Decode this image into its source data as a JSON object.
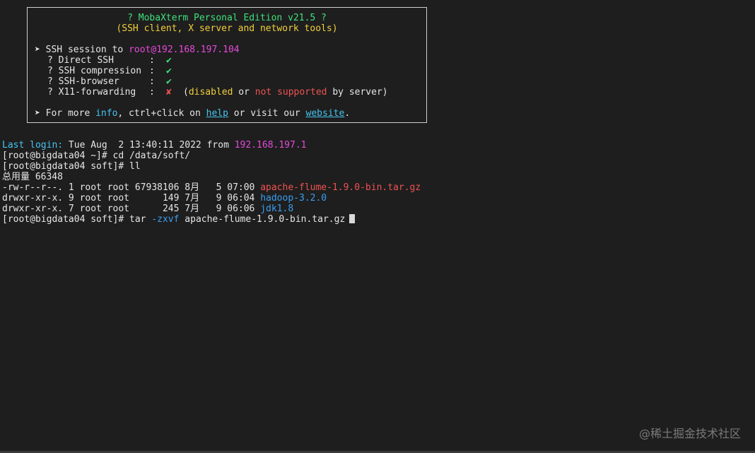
{
  "banner": {
    "title": "? MobaXterm Personal Edition v21.5 ?",
    "subtitle": "(SSH client, X server and network tools)",
    "session_prefix": "➤ SSH session to ",
    "session_target": "root@192.168.197.104",
    "checks": [
      {
        "mark": "?",
        "label": "Direct SSH",
        "value": "✔"
      },
      {
        "mark": "?",
        "label": "SSH compression",
        "value": "✔"
      },
      {
        "mark": "?",
        "label": "SSH-browser",
        "value": "✔"
      },
      {
        "mark": "?",
        "label": "X11-forwarding",
        "value": "✘"
      }
    ],
    "x11_paren_open": "(",
    "x11_disabled": "disabled",
    "x11_or": " or ",
    "x11_not_supported": "not supported",
    "x11_by_server": " by server)",
    "more_prefix": "➤ For more ",
    "more_info": "info",
    "more_mid": ", ctrl+click on ",
    "more_help": "help",
    "more_or": " or visit our ",
    "more_website": "website",
    "more_end": "."
  },
  "terminal": {
    "last_login_label": "Last login:",
    "last_login_time": " Tue Aug  2 13:40:11 2022 from ",
    "last_login_ip": "192.168.197.1",
    "line_cd": "[root@bigdata04 ~]# cd /data/soft/",
    "line_ll": "[root@bigdata04 soft]# ll",
    "total": "总用量 66348",
    "files": [
      {
        "meta": "-rw-r--r--. 1 root root 67938106 8月   5 07:00 ",
        "name": "apache-flume-1.9.0-bin.tar.gz",
        "color": "#f05252"
      },
      {
        "meta": "drwxr-xr-x. 9 root root      149 7月   9 06:04 ",
        "name": "hadoop-3.2.0",
        "color": "#3a9ef0"
      },
      {
        "meta": "drwxr-xr-x. 7 root root      245 7月   9 06:06 ",
        "name": "jdk1.8",
        "color": "#3a9ef0"
      }
    ],
    "cmd_prompt": "[root@bigdata04 soft]# tar ",
    "cmd_flag": "-zxvf",
    "cmd_arg": " apache-flume-1.9.0-bin.tar.gz"
  },
  "watermark": "@稀土掘金技术社区"
}
